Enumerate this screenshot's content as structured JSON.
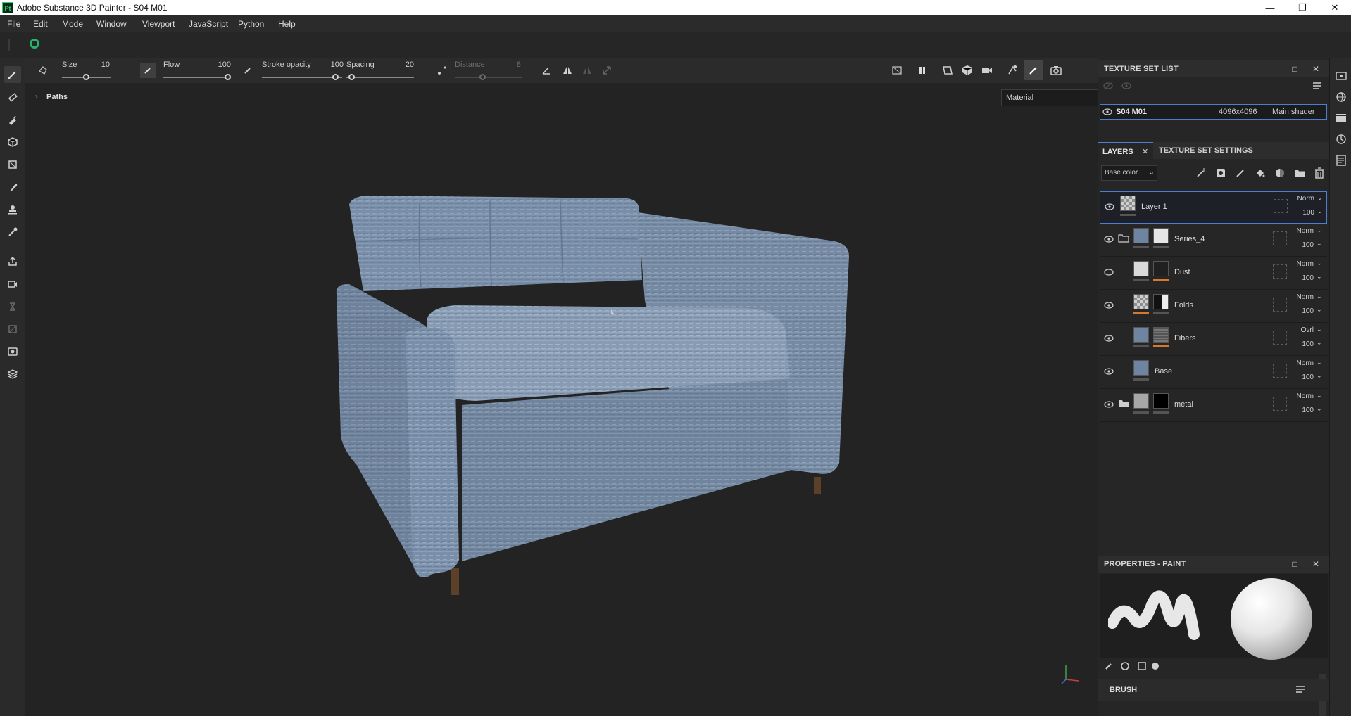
{
  "window": {
    "title": "Adobe Substance 3D Painter - S04 M01",
    "logo": "Pt"
  },
  "menu": [
    "File",
    "Edit",
    "Mode",
    "Window",
    "Viewport",
    "JavaScript",
    "Python",
    "Help"
  ],
  "tool_properties": {
    "size_label": "Size",
    "size_value": "10",
    "flow_label": "Flow",
    "flow_value": "100",
    "stroke_opacity_label": "Stroke opacity",
    "stroke_opacity_value": "100",
    "spacing_label": "Spacing",
    "spacing_value": "20",
    "distance_label": "Distance",
    "distance_value": "8"
  },
  "viewport": {
    "paths_label": "Paths",
    "material_mode": "Material"
  },
  "texture_set_list": {
    "title": "TEXTURE SET LIST",
    "row": {
      "name": "S04 M01",
      "resolution": "4096x4096",
      "shader": "Main shader"
    }
  },
  "layers_panel": {
    "tab_layers": "LAYERS",
    "tab_texture_set_settings": "TEXTURE SET SETTINGS",
    "channel": "Base color",
    "layers": [
      {
        "name": "Layer 1",
        "blend": "Norm",
        "opacity": "100"
      },
      {
        "name": "Series_4",
        "blend": "Norm",
        "opacity": "100"
      },
      {
        "name": "Dust",
        "blend": "Norm",
        "opacity": "100"
      },
      {
        "name": "Folds",
        "blend": "Norm",
        "opacity": "100"
      },
      {
        "name": "Fibers",
        "blend": "Ovrl",
        "opacity": "100"
      },
      {
        "name": "Base",
        "blend": "Norm",
        "opacity": "100"
      },
      {
        "name": "metal",
        "blend": "Norm",
        "opacity": "100"
      }
    ]
  },
  "properties": {
    "title": "PROPERTIES - PAINT",
    "brush_label": "BRUSH"
  },
  "colors": {
    "accent": "#4a7fd1",
    "shelf_green": "#27b36a",
    "mask_orange": "#d9782b",
    "fabric": "#7f94ad"
  }
}
